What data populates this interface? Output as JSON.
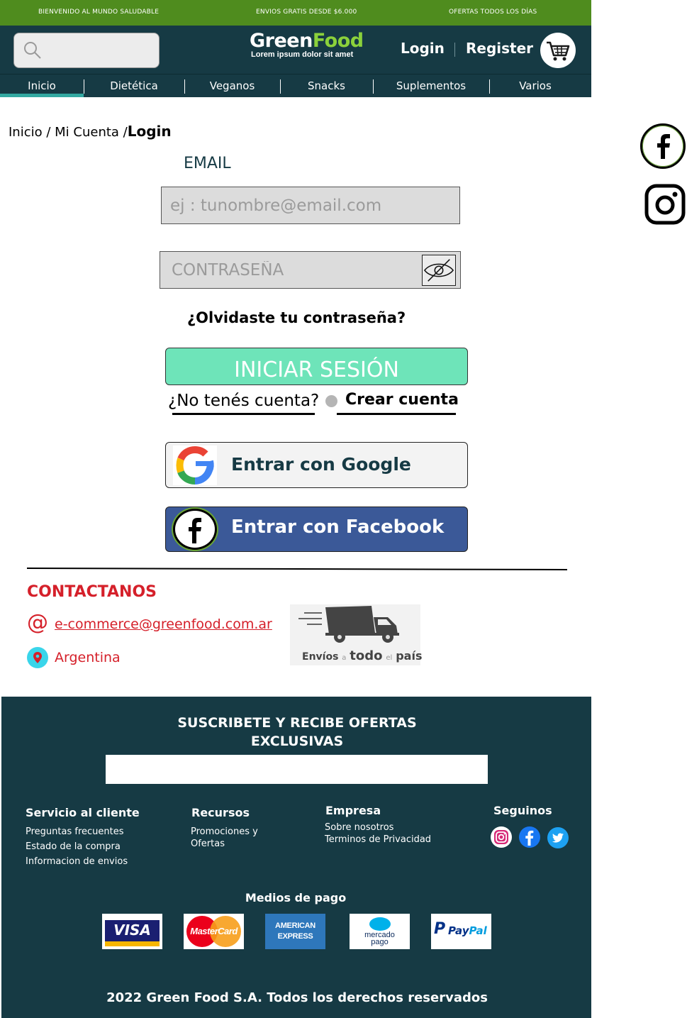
{
  "promo": {
    "left": "BIENVENIDO AL MUNDO SALUDABLE",
    "center": "ENVIOS GRATIS DESDE $6.000",
    "right": "OFERTAS TODOS LOS DÍAS"
  },
  "header": {
    "brand_part1": "Green",
    "brand_part2": "Food",
    "tagline": "Lorem ipsum dolor sit amet",
    "login": "Login",
    "register": "Register"
  },
  "nav": {
    "items": [
      "Inicio",
      "Dietética",
      "Veganos",
      "Snacks",
      "Suplementos",
      "Varios"
    ],
    "active": "Inicio"
  },
  "breadcrumb": {
    "path": "Inicio / Mi Cuenta /",
    "current": "Login"
  },
  "form": {
    "email_label": "EMAIL",
    "email_placeholder": "ej : tunombre@email.com",
    "password_placeholder": "CONTRASEÑA",
    "forgot": "¿Olvidaste tu contraseña?",
    "submit": "INICIAR SESIÓN",
    "no_account": "¿No tenés cuenta?",
    "create": "Crear cuenta",
    "google": "Entrar con Google",
    "facebook": "Entrar con Facebook"
  },
  "contact": {
    "title": "CONTACTANOS",
    "email": "e-commerce@greenfood.com.ar",
    "country": "Argentina",
    "shipping": {
      "word1": "Envíos",
      "word2": "a",
      "word3": "todo",
      "word4": "el",
      "word5": "país"
    }
  },
  "footer": {
    "subscribe_line1": "SUSCRIBETE Y RECIBE OFERTAS",
    "subscribe_line2": "EXCLUSIVAS",
    "columns": {
      "service": {
        "title": "Servicio al cliente",
        "links": [
          "Preguntas frecuentes",
          "Estado de la compra",
          "Informacion de envios"
        ]
      },
      "resources": {
        "title": "Recursos",
        "links": [
          "Promociones y",
          "Ofertas"
        ]
      },
      "company": {
        "title": "Empresa",
        "links": [
          "Sobre nosotros",
          "Terminos de Privacidad"
        ]
      },
      "follow": {
        "title": "Seguinos",
        "icons": [
          "instagram-icon",
          "facebook-icon",
          "twitter-icon"
        ]
      }
    },
    "payments_title": "Medios de pago",
    "payments": {
      "visa": "VISA",
      "mastercard": "MasterCard",
      "amex_line1": "AMERICAN",
      "amex_line2": "EXPRESS",
      "mercado_line1": "mercado",
      "mercado_line2": "pago",
      "paypal_part1": "Pay",
      "paypal_part2": "Pal"
    },
    "copyright": "2022 Green Food S.A. Todos los derechos reservados"
  },
  "colors": {
    "promo_bar": "#4f8c1e",
    "header": "#163a44",
    "accent_green": "#8bd13b",
    "login_button": "#6ee4b9",
    "contact_red": "#d5202a",
    "facebook_blue": "#3b5998"
  }
}
